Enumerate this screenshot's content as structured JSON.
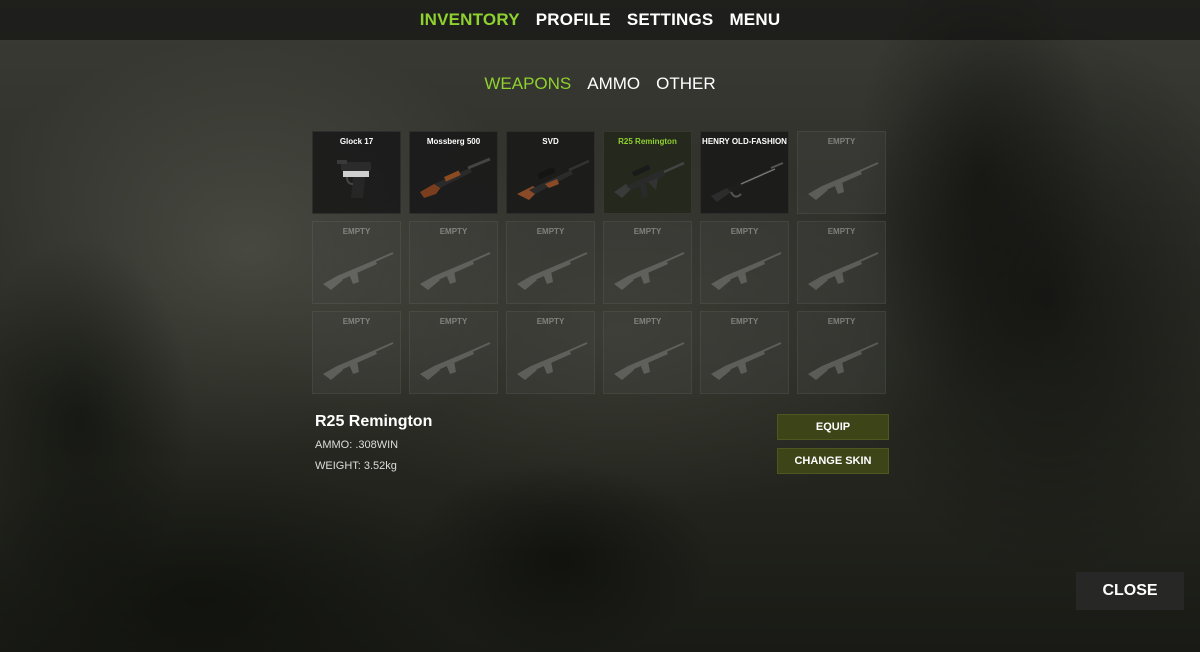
{
  "top_nav": [
    {
      "label": "INVENTORY",
      "active": true
    },
    {
      "label": "PROFILE",
      "active": false
    },
    {
      "label": "SETTINGS",
      "active": false
    },
    {
      "label": "MENU",
      "active": false
    }
  ],
  "sub_tabs": [
    {
      "label": "WEAPONS",
      "active": true
    },
    {
      "label": "AMMO",
      "active": false
    },
    {
      "label": "OTHER",
      "active": false
    }
  ],
  "slots": [
    {
      "name": "Glock 17",
      "icon": "pistol-icon",
      "state": "filled"
    },
    {
      "name": "Mossberg 500",
      "icon": "shotgun-icon",
      "state": "filled"
    },
    {
      "name": "SVD",
      "icon": "sniper-rifle-icon",
      "state": "filled"
    },
    {
      "name": "R25 Remington",
      "icon": "assault-rifle-icon",
      "state": "selected"
    },
    {
      "name": "HENRY OLD-FASHION",
      "icon": "lever-rifle-icon",
      "state": "filled"
    },
    {
      "name": "EMPTY",
      "icon": "rifle-placeholder-icon",
      "state": "empty"
    },
    {
      "name": "EMPTY",
      "icon": "rifle-placeholder-icon",
      "state": "empty"
    },
    {
      "name": "EMPTY",
      "icon": "rifle-placeholder-icon",
      "state": "empty"
    },
    {
      "name": "EMPTY",
      "icon": "rifle-placeholder-icon",
      "state": "empty"
    },
    {
      "name": "EMPTY",
      "icon": "rifle-placeholder-icon",
      "state": "empty"
    },
    {
      "name": "EMPTY",
      "icon": "rifle-placeholder-icon",
      "state": "empty"
    },
    {
      "name": "EMPTY",
      "icon": "rifle-placeholder-icon",
      "state": "empty"
    },
    {
      "name": "EMPTY",
      "icon": "rifle-placeholder-icon",
      "state": "empty"
    },
    {
      "name": "EMPTY",
      "icon": "rifle-placeholder-icon",
      "state": "empty"
    },
    {
      "name": "EMPTY",
      "icon": "rifle-placeholder-icon",
      "state": "empty"
    },
    {
      "name": "EMPTY",
      "icon": "rifle-placeholder-icon",
      "state": "empty"
    },
    {
      "name": "EMPTY",
      "icon": "rifle-placeholder-icon",
      "state": "empty"
    },
    {
      "name": "EMPTY",
      "icon": "rifle-placeholder-icon",
      "state": "empty"
    }
  ],
  "details": {
    "title": "R25 Remington",
    "ammo": "AMMO: .308WIN",
    "weight": "WEIGHT: 3.52kg"
  },
  "actions": {
    "equip_label": "EQUIP",
    "change_skin_label": "CHANGE SKIN",
    "close_label": "CLOSE"
  },
  "colors": {
    "accent": "#8fd12f",
    "button_bg": "#3c4418"
  }
}
